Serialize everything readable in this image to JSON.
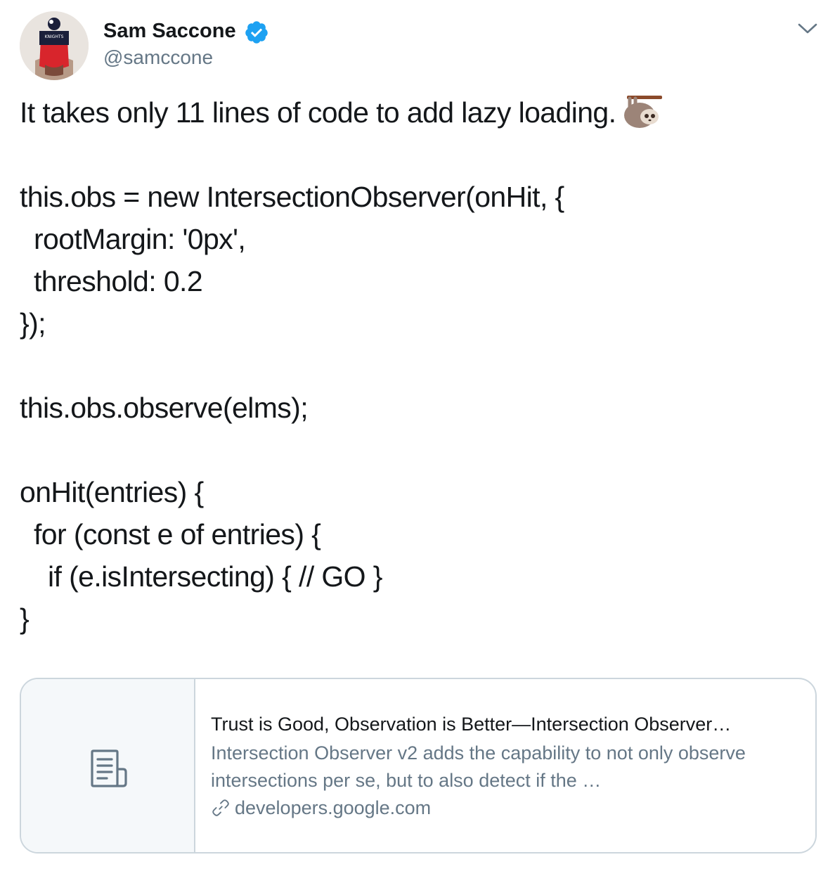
{
  "user": {
    "display_name": "Sam Saccone",
    "handle": "@samccone",
    "verified": true,
    "verified_color": "#1da1f2"
  },
  "avatar_icon": "avatar",
  "menu_icon": "chevron-down-icon",
  "tweet": {
    "lines": [
      "It takes only 11 lines of code to add lazy loading.",
      "",
      "this.obs = new IntersectionObserver(onHit, {",
      "rootMargin: '0px',",
      "threshold: 0.2",
      "});",
      "",
      "this.obs.observe(elms);",
      "",
      "onHit(entries) {",
      "for (const e of entries) {",
      "if (e.isIntersecting) { // GO }",
      "}"
    ],
    "emoji": "sloth-icon"
  },
  "card": {
    "title": "Trust is Good, Observation is Better—Intersection Observer…",
    "description": "Intersection Observer v2 adds the capability to not only observe intersections per se, but to also detect if the …",
    "domain": "developers.google.com",
    "thumb_icon": "document-icon",
    "link_icon": "link-icon"
  },
  "colors": {
    "text": "#14171a",
    "secondary": "#657786",
    "border": "#ccd6dd",
    "card_bg": "#f5f8fa"
  }
}
